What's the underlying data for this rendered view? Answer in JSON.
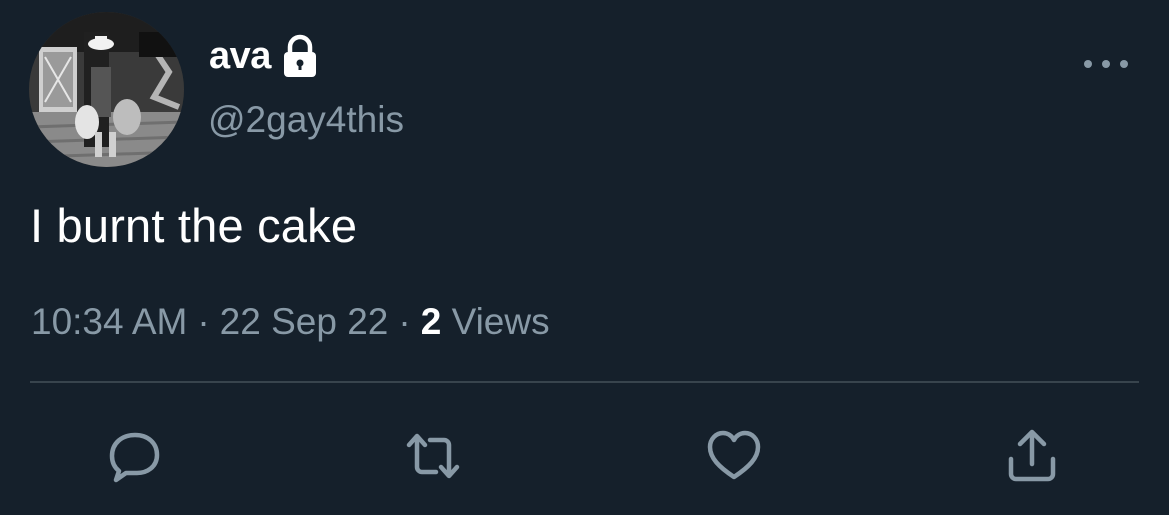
{
  "user": {
    "display_name": "ava",
    "handle": "@2gay4this",
    "protected_icon": "lock-icon",
    "avatar": "user-avatar-photo"
  },
  "tweet": {
    "text": "I burnt the cake",
    "time": "10:34 AM",
    "separator": "·",
    "date": "22 Sep 22",
    "views_count": "2",
    "views_label": "Views"
  },
  "icons": {
    "more": "more-horizontal-icon",
    "reply": "reply-icon",
    "retweet": "retweet-icon",
    "like": "heart-icon",
    "share": "share-icon"
  },
  "colors": {
    "background": "#15202b",
    "primary_text": "#ffffff",
    "secondary_text": "#8899a6",
    "divider": "#38444d"
  }
}
